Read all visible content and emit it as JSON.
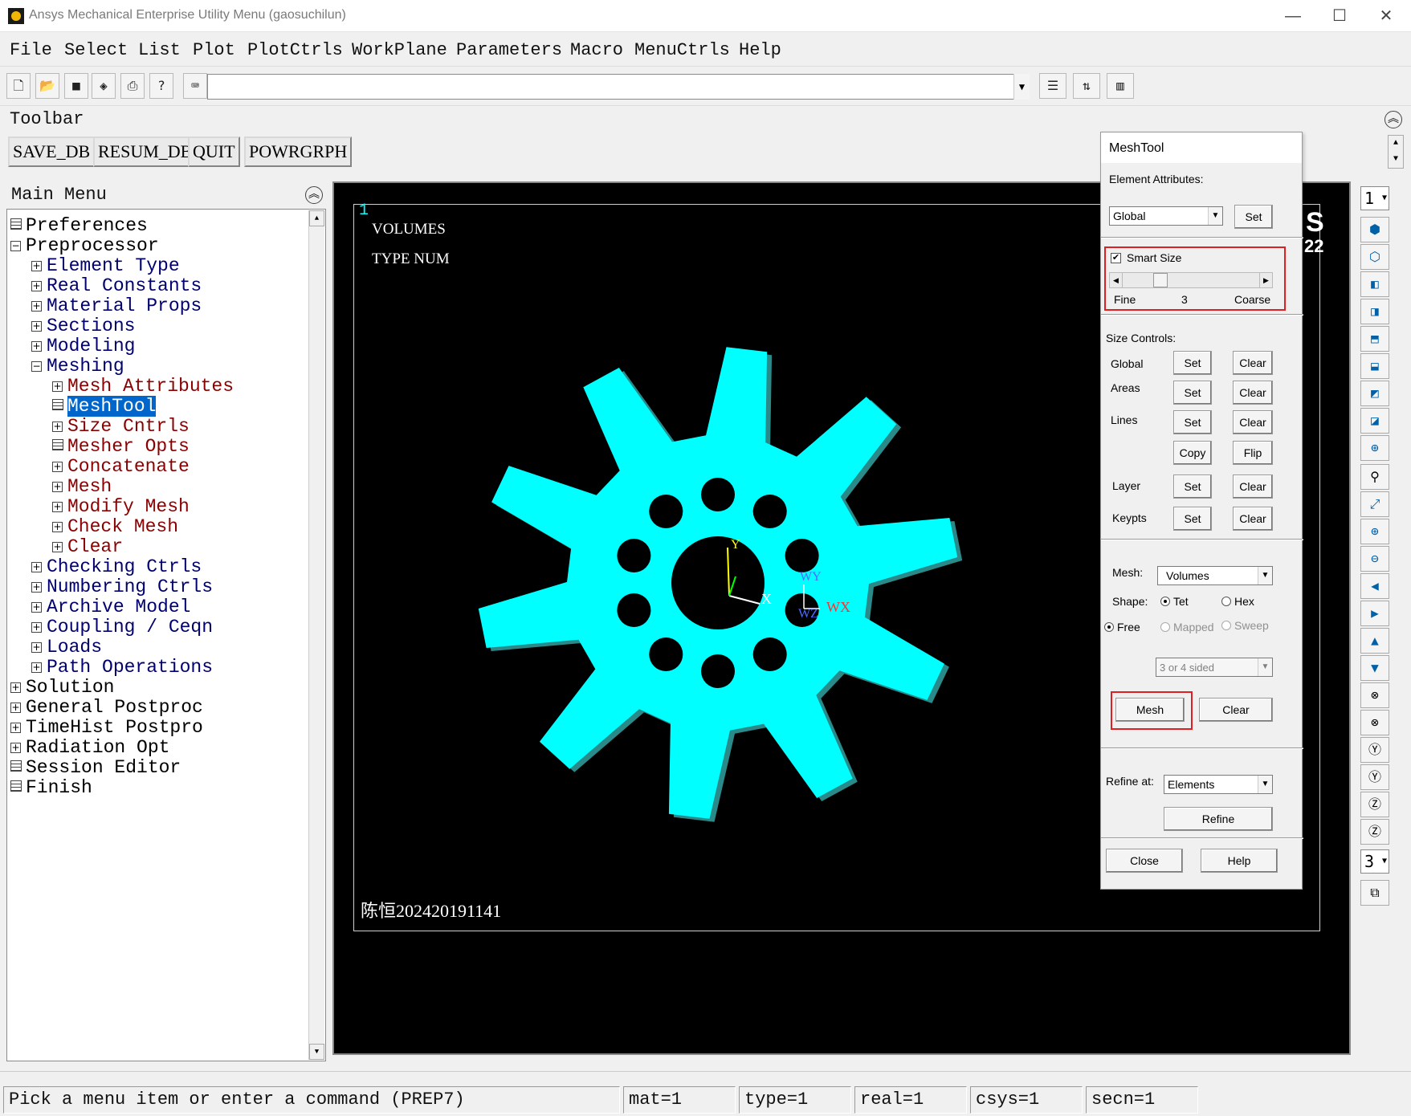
{
  "window": {
    "title": "Ansys Mechanical Enterprise Utility Menu (gaosuchilun)",
    "minimize": "—",
    "maximize": "☐",
    "close": "✕"
  },
  "menubar": [
    "File",
    "Select",
    "List",
    "Plot",
    "PlotCtrls",
    "WorkPlane",
    "Parameters",
    "Macro",
    "MenuCtrls",
    "Help"
  ],
  "command_input": {
    "value": ""
  },
  "toolbar": {
    "title": "Toolbar",
    "buttons": [
      "SAVE_DB",
      "RESUM_DB",
      "QUIT",
      "POWRGRPH"
    ]
  },
  "main_menu": {
    "title": "Main Menu",
    "items": [
      {
        "label": "Preferences"
      },
      {
        "label": "Preprocessor"
      },
      {
        "label": "Element Type"
      },
      {
        "label": "Real Constants"
      },
      {
        "label": "Material Props"
      },
      {
        "label": "Sections"
      },
      {
        "label": "Modeling"
      },
      {
        "label": "Meshing"
      },
      {
        "label": "Mesh Attributes"
      },
      {
        "label": "MeshTool"
      },
      {
        "label": "Size Cntrls"
      },
      {
        "label": "Mesher Opts"
      },
      {
        "label": "Concatenate"
      },
      {
        "label": "Mesh"
      },
      {
        "label": "Modify Mesh"
      },
      {
        "label": "Check Mesh"
      },
      {
        "label": "Clear"
      },
      {
        "label": "Checking Ctrls"
      },
      {
        "label": "Numbering Ctrls"
      },
      {
        "label": "Archive Model"
      },
      {
        "label": "Coupling / Ceqn"
      },
      {
        "label": "Loads"
      },
      {
        "label": "Path Operations"
      },
      {
        "label": "Solution"
      },
      {
        "label": "General Postproc"
      },
      {
        "label": "TimeHist Postpro"
      },
      {
        "label": "Radiation Opt"
      },
      {
        "label": "Session Editor"
      },
      {
        "label": "Finish"
      }
    ]
  },
  "graphics": {
    "window_number": "1",
    "label1": "VOLUMES",
    "label2": "TYPE NUM",
    "watermark": "陈恒202420191141",
    "axis_x": "X",
    "axis_y": "Y",
    "wp_x": "WX",
    "wp_y": "WY",
    "wp_z": "WZ",
    "logo_partial_1": "S",
    "logo_partial_2": "22",
    "fill_color": "#00ffff"
  },
  "right_toolbar": {
    "window_select": "1",
    "bottom_select": "3"
  },
  "meshtool": {
    "title": "MeshTool",
    "element_attributes_label": "Element Attributes:",
    "attr_select": "Global",
    "attr_set": "Set",
    "smart_size_label": "Smart Size",
    "smart_size_checked": true,
    "fine": "Fine",
    "smart_value": "3",
    "coarse": "Coarse",
    "size_controls_label": "Size Controls:",
    "rows": [
      {
        "label": "Global",
        "set": "Set",
        "clear": "Clear"
      },
      {
        "label": "Areas",
        "set": "Set",
        "clear": "Clear"
      },
      {
        "label": "Lines",
        "set": "Set",
        "clear": "Clear"
      },
      {
        "label": "",
        "set": "Copy",
        "clear": "Flip"
      },
      {
        "label": "Layer",
        "set": "Set",
        "clear": "Clear"
      },
      {
        "label": "Keypts",
        "set": "Set",
        "clear": "Clear"
      }
    ],
    "mesh_label": "Mesh:",
    "mesh_select": "Volumes",
    "shape_label": "Shape:",
    "tet": "Tet",
    "hex": "Hex",
    "free": "Free",
    "mapped": "Mapped",
    "sweep": "Sweep",
    "sided_select": "3 or 4 sided",
    "mesh_button": "Mesh",
    "clear_button": "Clear",
    "refine_at_label": "Refine at:",
    "refine_select": "Elements",
    "refine_button": "Refine",
    "close_button": "Close",
    "help_button": "Help"
  },
  "statusbar": {
    "prompt": "Pick a menu item or enter a command (PREP7)",
    "mat": "mat=1",
    "type": "type=1",
    "real": "real=1",
    "csys": "csys=1",
    "secn": "secn=1"
  }
}
